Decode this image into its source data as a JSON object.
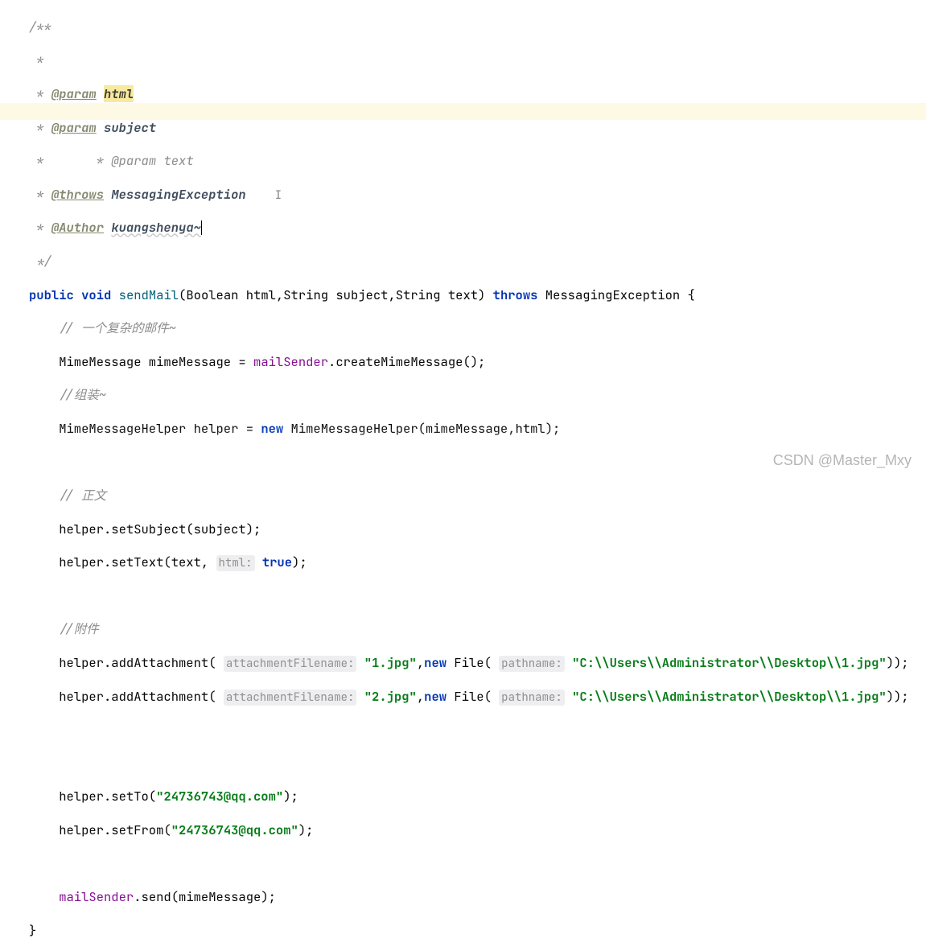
{
  "doc": {
    "open": "/**",
    "star": " *",
    "close": " */",
    "param_tag": "@param",
    "throws_tag": "@throws",
    "author_tag": "@Author",
    "param1": "html",
    "param2": "subject",
    "param3": "text",
    "throws_val": "MessagingException",
    "author_val": "kuangshenya~"
  },
  "kw": {
    "public": "public",
    "void": "void",
    "throws": "throws",
    "new": "new",
    "true": "true"
  },
  "sig": {
    "method": "sendMail",
    "params": "(Boolean html,String subject,String text) ",
    "exception": "MessagingException",
    "open_brace": " {"
  },
  "c": {
    "c1": "// 一个复杂的邮件~",
    "c2": "//组装~",
    "c3": "// 正文",
    "c4": "//附件"
  },
  "l": {
    "mime_decl": "MimeMessage mimeMessage = ",
    "mailSender": "mailSender",
    "create": ".createMimeMessage();",
    "helper_decl": "MimeMessageHelper helper = ",
    "helper_ctor": " MimeMessageHelper(mimeMessage,html);",
    "setSubject": "helper.setSubject(subject);",
    "setText_a": "helper.setText(text, ",
    "hint_html": "html:",
    "setText_b": ");",
    "addAtt_a": "helper.addAttachment( ",
    "hint_attfile": "attachmentFilename:",
    "str_1jpg": "\"1.jpg\"",
    "str_2jpg": "\"2.jpg\"",
    "comma_newfile": ",",
    "file_open": " File( ",
    "hint_pathname": "pathname:",
    "str_path": "\"C:\\\\Users\\\\Administrator\\\\Desktop\\\\1.jpg\"",
    "file_close": "));",
    "setTo_a": "helper.setTo(",
    "setFrom_a": "helper.setFrom(",
    "str_email": "\"24736743@qq.com\"",
    "close_paren": ");",
    "send": ".send(mimeMessage);",
    "close_brace": "}"
  },
  "caret": "I",
  "watermark": "CSDN @Master_Mxy"
}
